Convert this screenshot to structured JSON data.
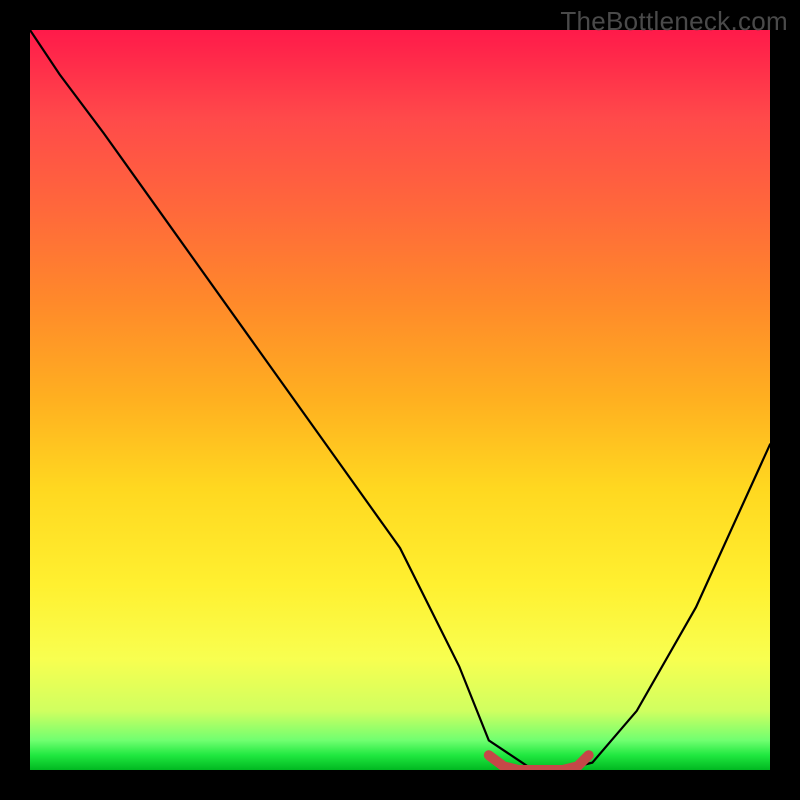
{
  "watermark": "TheBottleneck.com",
  "chart_data": {
    "type": "line",
    "title": "",
    "xlabel": "",
    "ylabel": "",
    "xlim": [
      0,
      100
    ],
    "ylim": [
      0,
      100
    ],
    "series": [
      {
        "name": "bottleneck-curve",
        "x": [
          0,
          4,
          10,
          20,
          30,
          40,
          50,
          58,
          62,
          68,
          72,
          76,
          82,
          90,
          100
        ],
        "y": [
          100,
          94,
          86,
          72,
          58,
          44,
          30,
          14,
          4,
          0,
          0,
          1,
          8,
          22,
          44
        ]
      }
    ],
    "highlight": {
      "name": "optimal-range",
      "x": [
        62,
        64,
        66,
        68,
        70,
        72,
        74,
        75.5
      ],
      "y": [
        2,
        0.5,
        0,
        0,
        0,
        0,
        0.5,
        2
      ],
      "color": "#c54848"
    },
    "gradient_stops": [
      {
        "pos": 0,
        "color": "#ff1a4a"
      },
      {
        "pos": 50,
        "color": "#ffd820"
      },
      {
        "pos": 92,
        "color": "#d0ff60"
      },
      {
        "pos": 100,
        "color": "#00b820"
      }
    ]
  }
}
